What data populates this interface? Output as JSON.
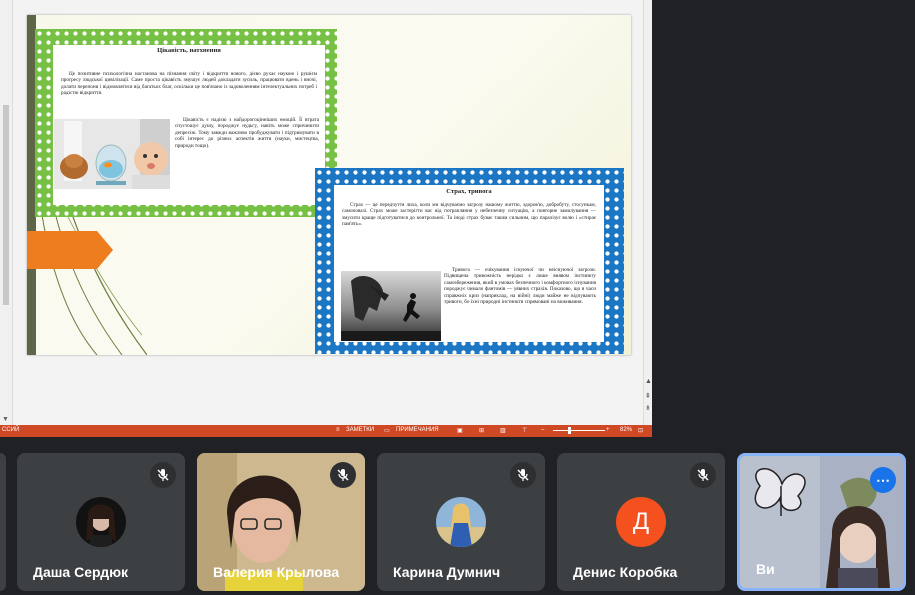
{
  "slide": {
    "card1": {
      "title": "Цікавість, натхнення",
      "p1": "Це позитивне психологічна настанова на пізнання світу і відкриття нового, дієво рухає наукою і рушієм прогресу людської цивілізації. Саме проста цікавість змушує людей докладати зусиль, працювати вдень і вночі, долати перепони і відмовлятися від багатьох благ, оскільки це пов'язано із задоволенням інтелектуальних потреб і радістю відкриття.",
      "p2": "Цікавість є надією з найдорогоцінніших емоцій. Її втрата спустошує душу, породжує нудьгу, навіть може спричинити депресію. Тому завжди важливо пробуджувати і підтримувати в собі інтерес до різних аспектів життя (науки, мистецтва, природи тощо)."
    },
    "card2": {
      "title": "Страх, тривога",
      "p1": "Страх — це передчуття лиха, коли ми відчуваємо загрозу нашому життю, здоров'ю, добробуту, стосункам, самоповазі. Страх може застерігти вас від потрапляння у небезпечну ситуацію, а повторне замилування — змусити краще підготуватися до контрольної. Та іноді страх буває таким сильним, що паралізує волю і «стирає пам'ять».",
      "p2": "Тривога — очікування існуючої чи неіснуючої загрози. Підвищена тривожність нерідко є лише виявом інстинкту самозбереження, який в умовах безпечного і комфортного існування породжує чимало фантомів — уявних страхів. Показово, що в часи справжніх криз (наприклад, на війні) люди майже не відчувають тривоги, бо їхні природні інстинкти спрямовані на виживання."
    }
  },
  "statusbar": {
    "language": "ССИЙ",
    "notes": "ЗАМЕТКИ",
    "comments": "ПРИМЕЧАНИЯ",
    "zoom": "82%"
  },
  "participants": [
    {
      "name": "Даша Сердюк"
    },
    {
      "name": "Валерия Крылова"
    },
    {
      "name": "Карина Думнич"
    },
    {
      "name": "Денис Коробка",
      "initial": "Д"
    },
    {
      "name": "Ви"
    }
  ],
  "colors": {
    "green_frame": "#76c043",
    "blue_frame": "#1b76c4",
    "status_bar": "#d04925",
    "tile_bg": "#3c4043",
    "self_border": "#8ab4f8",
    "avatar_letter": "#f4511e"
  }
}
